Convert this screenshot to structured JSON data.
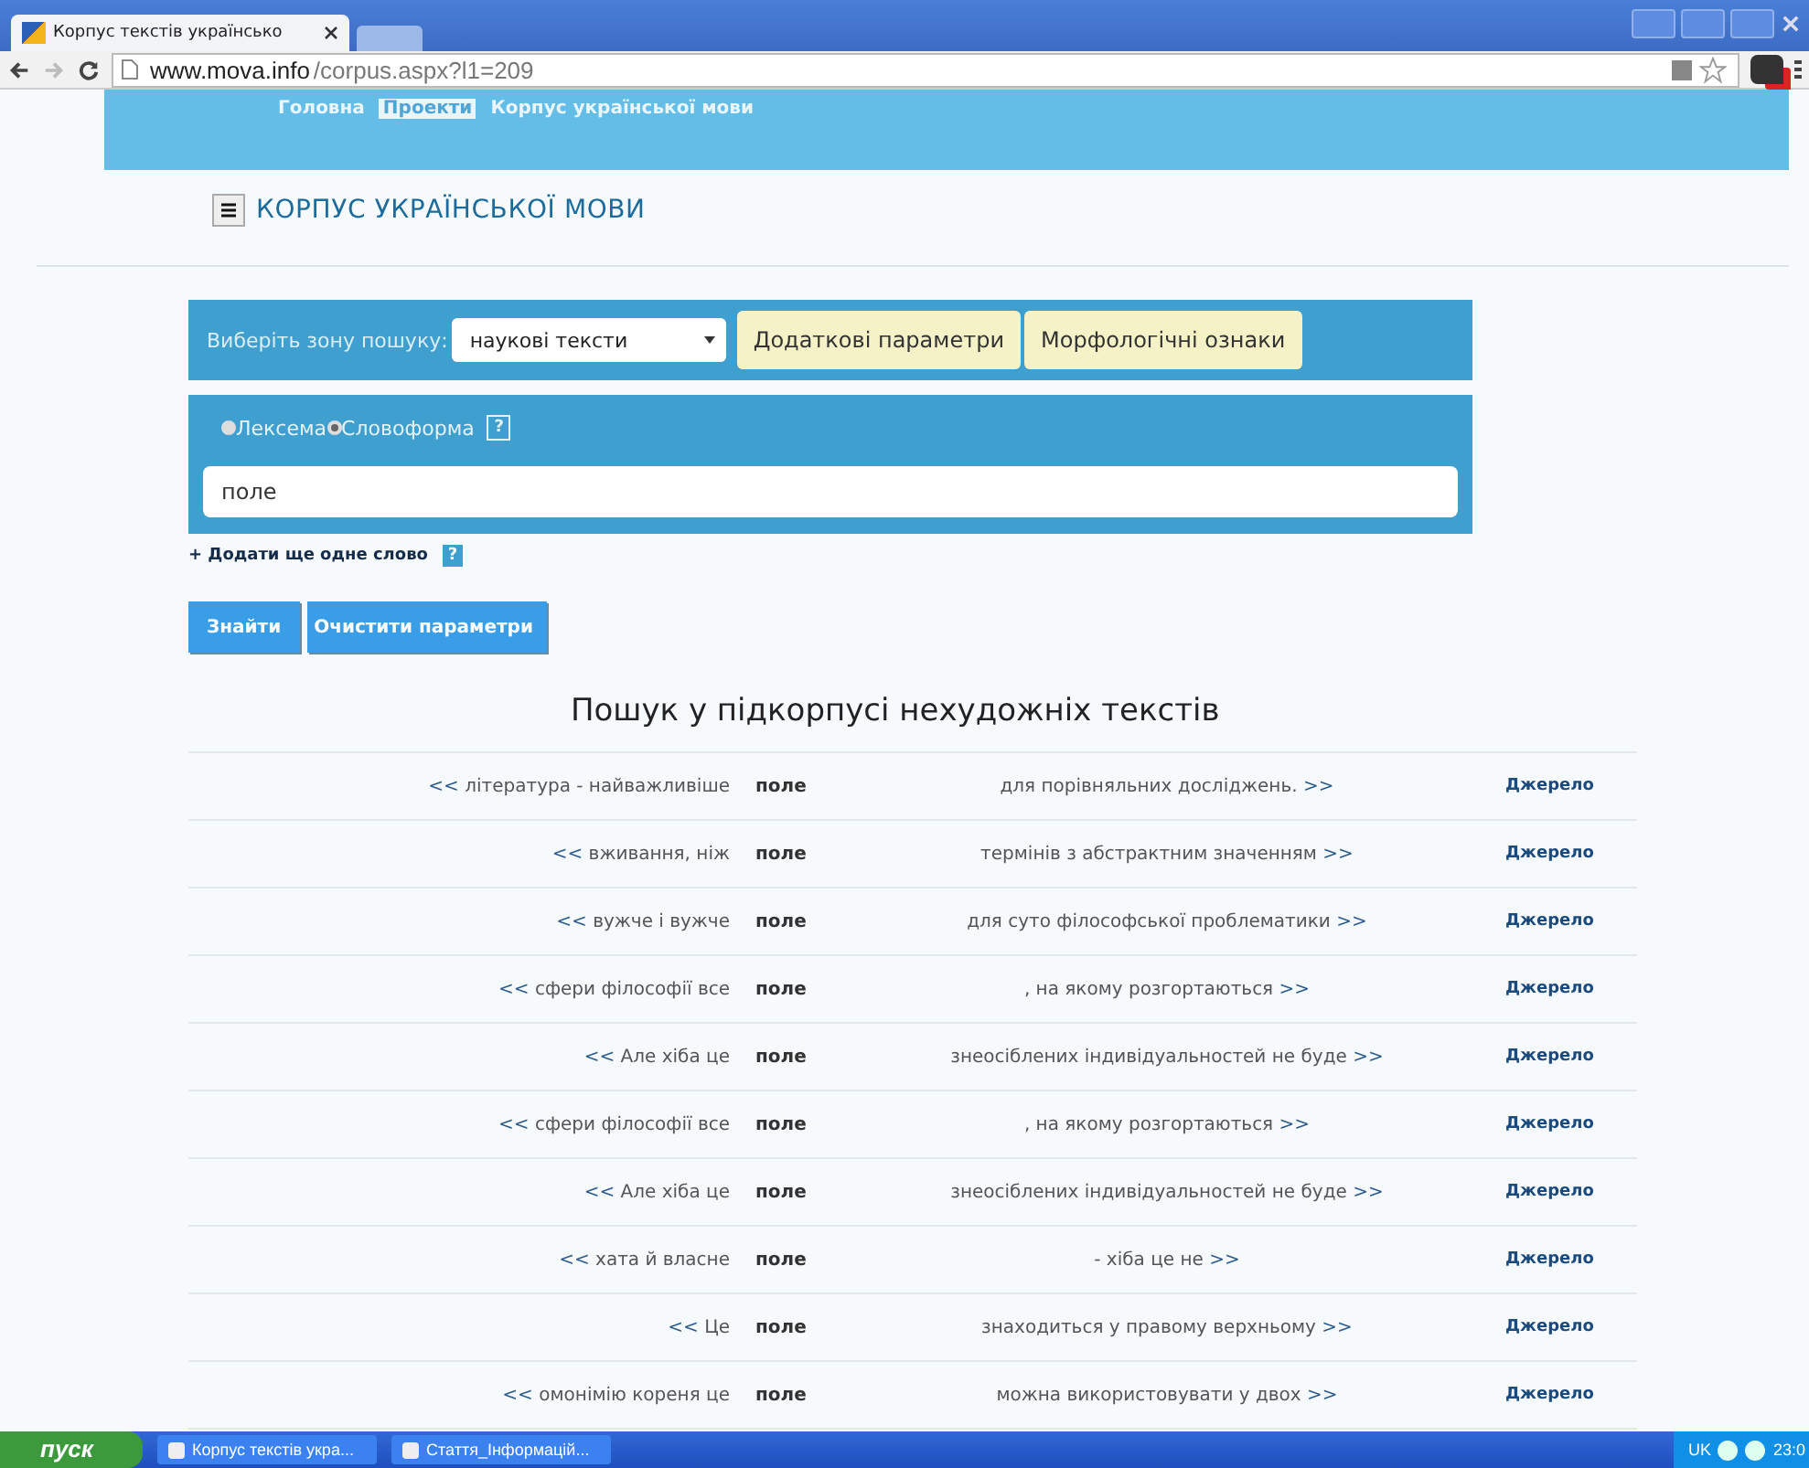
{
  "browser": {
    "tab_title": "Корпус текстів українсько",
    "url_host": "www.mova.info",
    "url_path": "/corpus.aspx?l1=209"
  },
  "breadcrumb": [
    {
      "label": "Головна",
      "selected": false
    },
    {
      "label": "Проекти",
      "selected": true
    },
    {
      "label": "Корпус української мови",
      "selected": false
    }
  ],
  "site_title": "КОРПУС УКРАЇНСЬКОЇ МОВИ",
  "search": {
    "zone_label": "Виберіть зону пошуку:",
    "zone_value": "наукові тексти",
    "tabs": [
      "Додаткові параметри",
      "Морфологічні ознаки"
    ],
    "modes": [
      {
        "label": "Лексема",
        "selected": false
      },
      {
        "label": "Словоформа",
        "selected": true
      }
    ],
    "help": "?",
    "query": "поле",
    "add_word": "+ Додати ще одне слово",
    "add_help": "?",
    "buttons": [
      "Знайти",
      "Очистити параметри"
    ]
  },
  "results_title": "Пошук у підкорпусі нехудожніх текстів",
  "rows": [
    {
      "left_link": "<<",
      "left": "література - найважливіше",
      "keyword": "поле",
      "right": "для порівняльних досліджень.",
      "right_link": ">>",
      "source": "Джерело"
    },
    {
      "left_link": "<<",
      "left": "вживання, ніж",
      "keyword": "поле",
      "right": "термінів з абстрактним значенням",
      "right_link": ">>",
      "source": "Джерело"
    },
    {
      "left_link": "<<",
      "left": "вужче і вужче",
      "keyword": "поле",
      "right": "для суто філософської проблематики",
      "right_link": ">>",
      "source": "Джерело"
    },
    {
      "left_link": "<<",
      "left": "сфери філософії все",
      "keyword": "поле",
      "right": ", на якому розгортаються",
      "right_link": ">>",
      "source": "Джерело"
    },
    {
      "left_link": "<<",
      "left": "Але хіба це",
      "keyword": "поле",
      "right": "знеосіблених індивідуальностей не буде",
      "right_link": ">>",
      "source": "Джерело"
    },
    {
      "left_link": "<<",
      "left": "сфери філософії все",
      "keyword": "поле",
      "right": ", на якому розгортаються",
      "right_link": ">>",
      "source": "Джерело"
    },
    {
      "left_link": "<<",
      "left": "Але хіба це",
      "keyword": "поле",
      "right": "знеосіблених індивідуальностей не буде",
      "right_link": ">>",
      "source": "Джерело"
    },
    {
      "left_link": "<<",
      "left": "хата й власне",
      "keyword": "поле",
      "right": "- хіба це не",
      "right_link": ">>",
      "source": "Джерело"
    },
    {
      "left_link": "<<",
      "left": "Це",
      "keyword": "поле",
      "right": "знаходиться у правому верхньому",
      "right_link": ">>",
      "source": "Джерело"
    },
    {
      "left_link": "<<",
      "left": "омонімію кореня це",
      "keyword": "поле",
      "right": "можна використовувати у двох",
      "right_link": ">>",
      "source": "Джерело"
    }
  ],
  "taskbar": {
    "start": "пуск",
    "windows": [
      "Корпус текстів укра...",
      "Стаття_Інформацій..."
    ],
    "lang": "UK",
    "clock": "23:0"
  }
}
